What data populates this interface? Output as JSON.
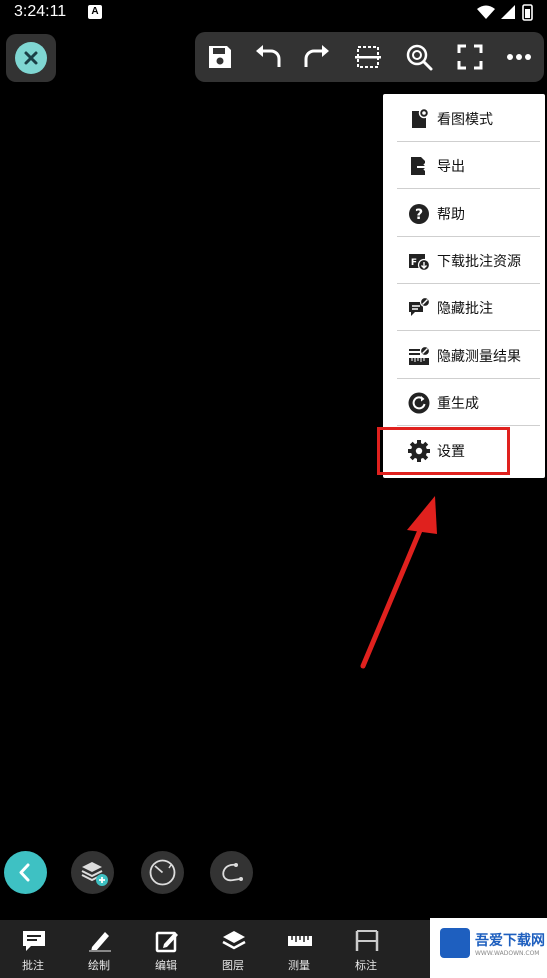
{
  "status_bar": {
    "time": "3:24:11",
    "badge": "A"
  },
  "toolbar": {
    "icons": [
      "save-icon",
      "undo-icon",
      "redo-icon",
      "fit-width-icon",
      "zoom-icon",
      "fullscreen-icon",
      "more-icon"
    ]
  },
  "menu": {
    "items": [
      {
        "label": "看图模式",
        "icon": "view-mode-icon"
      },
      {
        "label": "导出",
        "icon": "export-icon"
      },
      {
        "label": "帮助",
        "icon": "help-icon"
      },
      {
        "label": "下载批注资源",
        "icon": "download-annotations-icon"
      },
      {
        "label": "隐藏批注",
        "icon": "hide-annotations-icon"
      },
      {
        "label": "隐藏测量结果",
        "icon": "hide-measurements-icon"
      },
      {
        "label": "重生成",
        "icon": "regenerate-icon"
      },
      {
        "label": "设置",
        "icon": "settings-icon"
      }
    ],
    "highlight_color": "#e0211e"
  },
  "float_buttons": [
    "back-icon",
    "layers-add-icon",
    "dial-icon",
    "curve-icon"
  ],
  "bottom_nav": {
    "items": [
      {
        "label": "批注",
        "icon": "comment-icon"
      },
      {
        "label": "绘制",
        "icon": "pencil-icon"
      },
      {
        "label": "编辑",
        "icon": "edit-icon"
      },
      {
        "label": "图层",
        "icon": "layers-icon"
      },
      {
        "label": "测量",
        "icon": "ruler-icon"
      },
      {
        "label": "标注",
        "icon": "dimension-icon"
      }
    ]
  },
  "watermark": {
    "text": "吾爱下载网",
    "sub": "WWW.WADOWN.COM"
  },
  "colors": {
    "accent": "#3ec1c3",
    "close": "#7fd6d2",
    "toolbar_bg": "#333333"
  }
}
